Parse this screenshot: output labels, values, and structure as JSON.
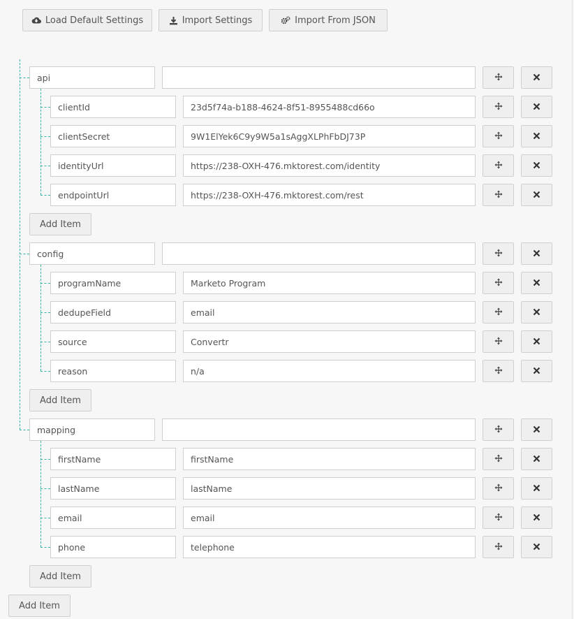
{
  "toolbar": {
    "load_default_label": "Load Default Settings",
    "import_settings_label": "Import Settings",
    "import_json_label": "Import From JSON"
  },
  "groups": [
    {
      "key": "api",
      "value": "",
      "items": [
        {
          "key": "clientId",
          "value": "23d5f74a-b188-4624-8f51-8955488cd66o"
        },
        {
          "key": "clientSecret",
          "value": "9W1ElYek6C9y9W5a1sAggXLPhFbDJ73P"
        },
        {
          "key": "identityUrl",
          "value": "https://238-OXH-476.mktorest.com/identity"
        },
        {
          "key": "endpointUrl",
          "value": "https://238-OXH-476.mktorest.com/rest"
        }
      ],
      "add_item_label": "Add Item"
    },
    {
      "key": "config",
      "value": "",
      "items": [
        {
          "key": "programName",
          "value": "Marketo Program"
        },
        {
          "key": "dedupeField",
          "value": "email"
        },
        {
          "key": "source",
          "value": "Convertr"
        },
        {
          "key": "reason",
          "value": "n/a"
        }
      ],
      "add_item_label": "Add Item"
    },
    {
      "key": "mapping",
      "value": "",
      "items": [
        {
          "key": "firstName",
          "value": "firstName"
        },
        {
          "key": "lastName",
          "value": "lastName"
        },
        {
          "key": "email",
          "value": "email"
        },
        {
          "key": "phone",
          "value": "telephone"
        }
      ],
      "add_item_label": "Add Item"
    }
  ],
  "root_add_item_label": "Add Item",
  "icons": {
    "move": "move-arrows-icon",
    "remove": "close-icon",
    "cloud": "cloud-download-icon",
    "download": "download-icon",
    "gears": "gears-icon"
  },
  "colors": {
    "tree_line": "#38b2a5",
    "button_bg": "#efefef",
    "border": "#cfcfcf"
  }
}
